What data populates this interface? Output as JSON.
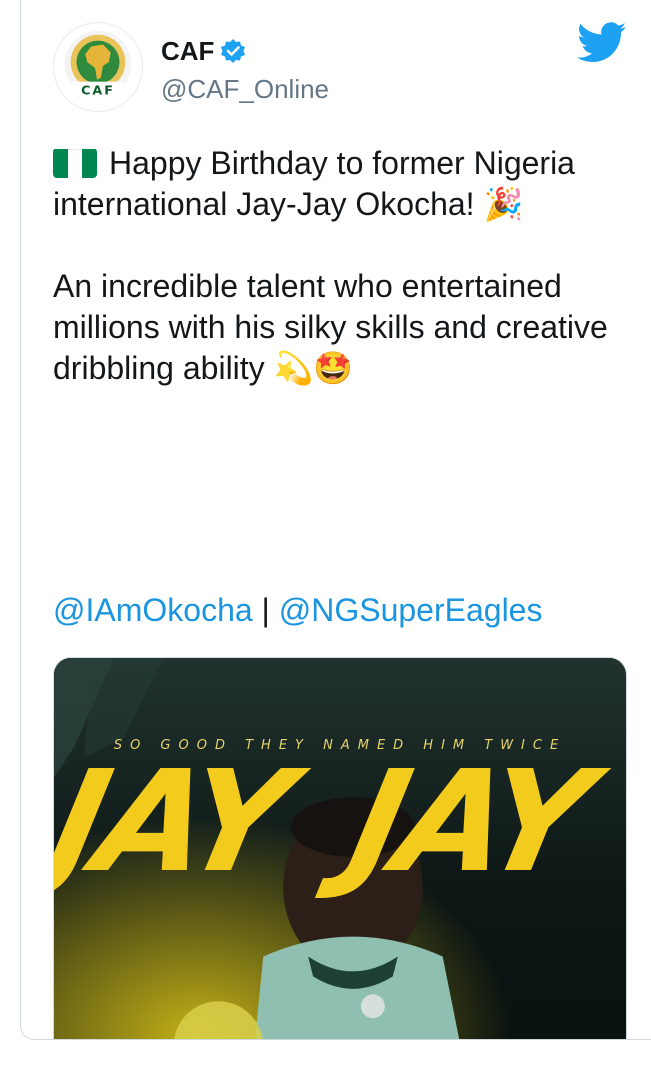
{
  "author": {
    "display_name": "CAF",
    "handle": "@CAF_Online",
    "avatar_text": "CAF",
    "verified": true
  },
  "tweet": {
    "line1": "Happy Birthday to former Nigeria international Jay-Jay Okocha! 🎉",
    "line2": "An incredible talent who entertained millions with his silky skills and creative dribbling ability 💫🤩",
    "mention1": "@IAmOkocha",
    "separator": " | ",
    "mention2": "@NGSuperEagles"
  },
  "media": {
    "tagline": "SO GOOD THEY NAMED HIM TWICE",
    "word_left": "JAY",
    "word_right": "JAY"
  },
  "colors": {
    "brand_blue": "#1da1f2",
    "mention": "#1b95e0",
    "handle_gray": "#657786",
    "flag_green": "#008751",
    "jay_yellow": "#f2cb1d"
  },
  "icons": {
    "platform": "twitter-bird-icon",
    "verified": "verified-badge-icon",
    "flag": "nigeria-flag-icon"
  }
}
